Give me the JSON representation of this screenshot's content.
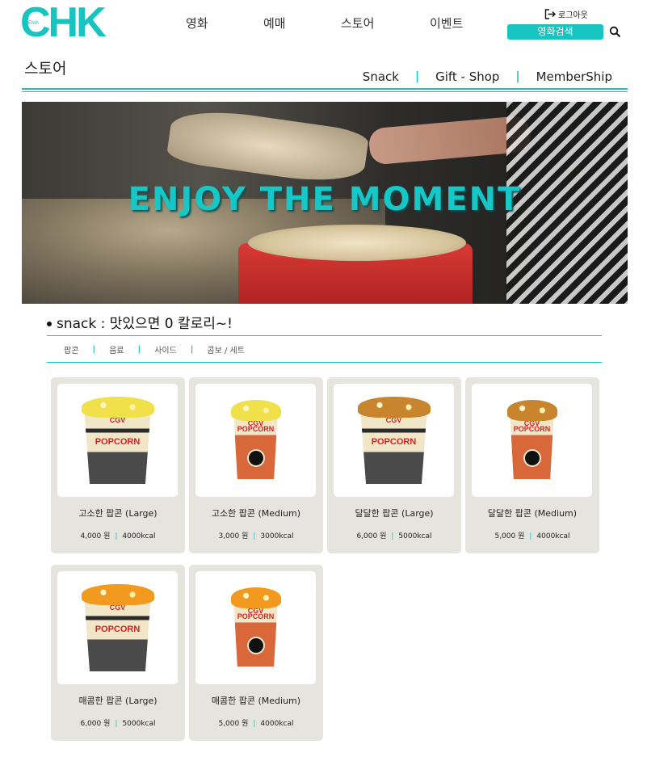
{
  "header": {
    "logo_text": "CHK",
    "logo_small": "INEMA",
    "nav": [
      "영화",
      "예매",
      "스토어",
      "이벤트"
    ],
    "logout_label": "로그아웃",
    "search_button_label": "영화검색"
  },
  "store": {
    "title": "스토어",
    "subnav": [
      "Snack",
      "Gift - Shop",
      "MemberShip"
    ]
  },
  "banner": {
    "headline": "ENJOY THE MOMENT"
  },
  "snack": {
    "section_title": "snack : 맛있으면 0 칼로리~!",
    "tabs": [
      "팝콘",
      "음료",
      "사이드",
      "콤보 / 세트"
    ],
    "products": [
      {
        "name": "고소한 팝콘 (Large)",
        "price": "4,000 원",
        "kcal": "4000kcal",
        "flavor": "plain",
        "size": "large"
      },
      {
        "name": "고소한 팝콘 (Medium)",
        "price": "3,000 원",
        "kcal": "3000kcal",
        "flavor": "plain",
        "size": "medium"
      },
      {
        "name": "달달한 팝콘 (Large)",
        "price": "6,000 원",
        "kcal": "5000kcal",
        "flavor": "caramel",
        "size": "large"
      },
      {
        "name": "달달한 팝콘 (Medium)",
        "price": "5,000 원",
        "kcal": "4000kcal",
        "flavor": "caramel",
        "size": "medium"
      },
      {
        "name": "매콤한 팝콘 (Large)",
        "price": "6,000 원",
        "kcal": "5000kcal",
        "flavor": "spicy",
        "size": "large"
      },
      {
        "name": "매콤한 팝콘 (Medium)",
        "price": "5,000 원",
        "kcal": "4000kcal",
        "flavor": "spicy",
        "size": "medium"
      }
    ],
    "cup_brand": "CGV",
    "cup_text": "POPCORN"
  },
  "colors": {
    "accent": "#17c4c0",
    "card_bg": "#e6e4df",
    "popcorn_plain": "#f0e04a",
    "popcorn_caramel": "#c8852d",
    "popcorn_spicy": "#f29a1f"
  }
}
